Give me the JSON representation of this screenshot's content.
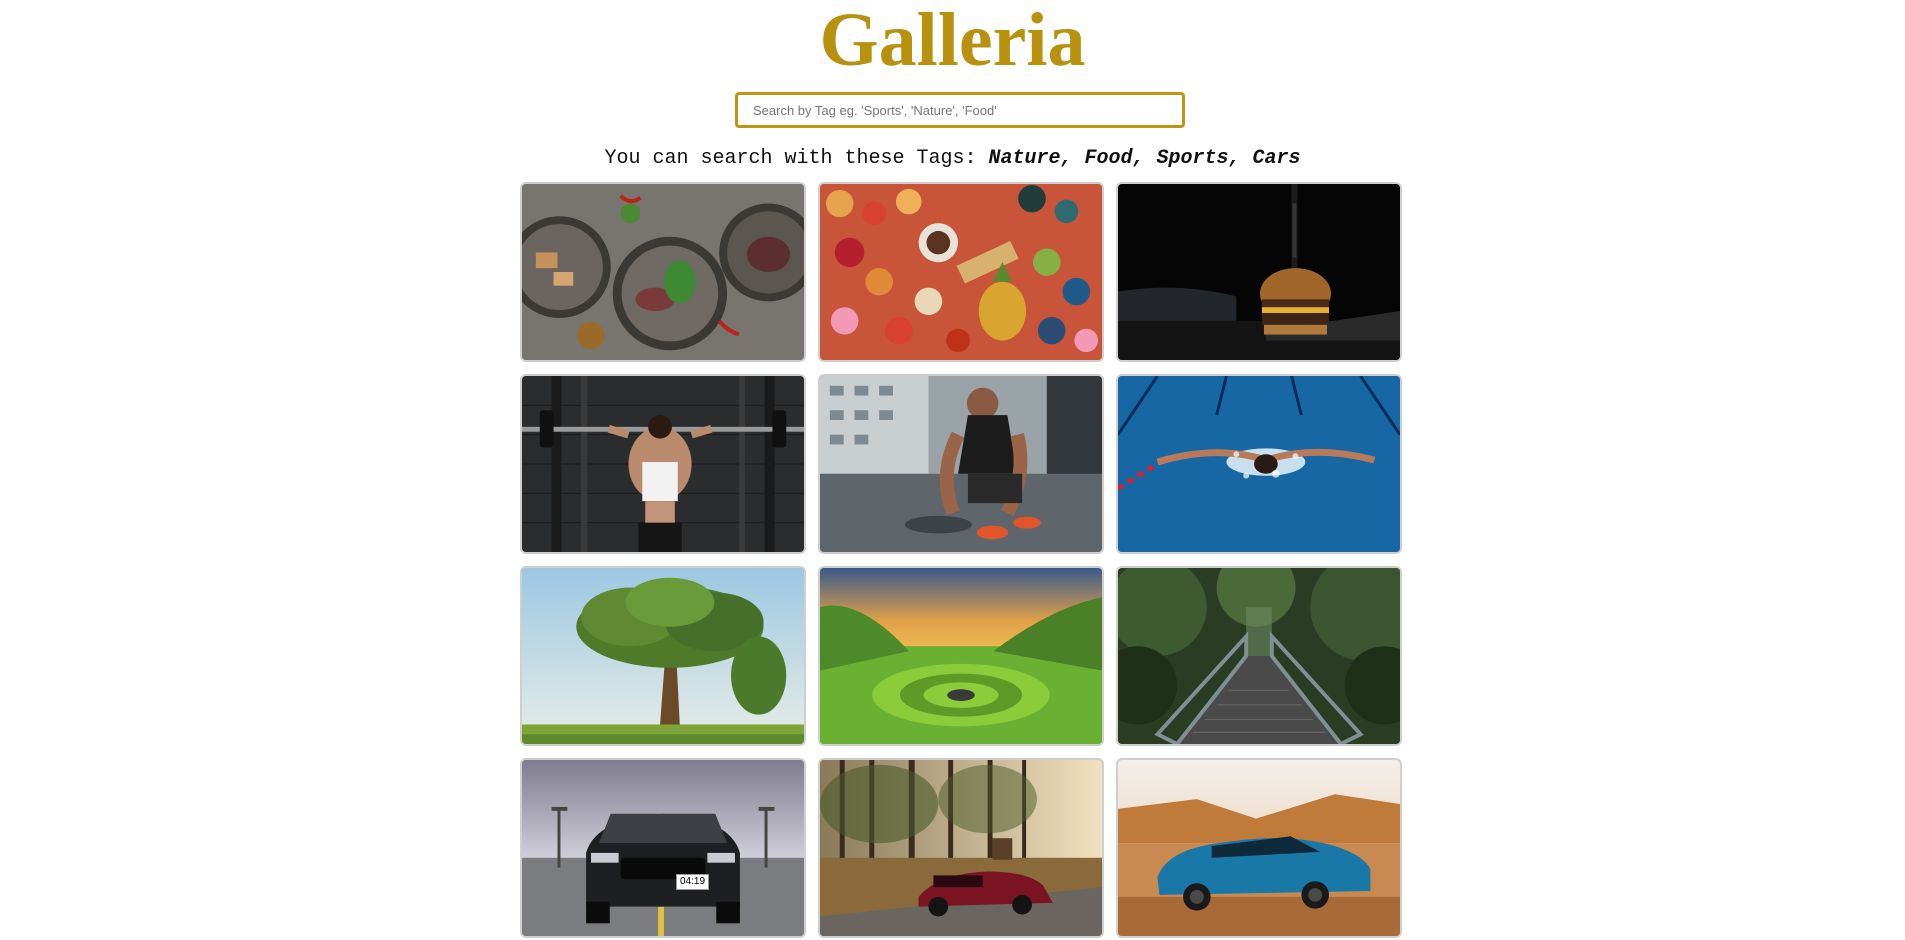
{
  "app": {
    "title": "Galleria"
  },
  "search": {
    "placeholder": "Search by Tag eg. 'Sports', 'Nature', 'Food'",
    "value": ""
  },
  "tags": {
    "prefix": "You can search with these Tags: ",
    "list": "Nature, Food, Sports, Cars"
  },
  "gallery": {
    "items": [
      {
        "tag": "Food",
        "subject": "salad-plates"
      },
      {
        "tag": "Food",
        "subject": "fruit-spread"
      },
      {
        "tag": "Food",
        "subject": "burger"
      },
      {
        "tag": "Sports",
        "subject": "weightlifting"
      },
      {
        "tag": "Sports",
        "subject": "runner-tying-shoe"
      },
      {
        "tag": "Sports",
        "subject": "swimmer"
      },
      {
        "tag": "Nature",
        "subject": "tree"
      },
      {
        "tag": "Nature",
        "subject": "green-valley"
      },
      {
        "tag": "Nature",
        "subject": "forest-bridge"
      },
      {
        "tag": "Cars",
        "subject": "black-mustang",
        "badge": "04:19"
      },
      {
        "tag": "Cars",
        "subject": "red-sports-car"
      },
      {
        "tag": "Cars",
        "subject": "blue-camaro"
      }
    ]
  },
  "colors": {
    "accent": "#b8910f",
    "search_border": "#c09512"
  }
}
